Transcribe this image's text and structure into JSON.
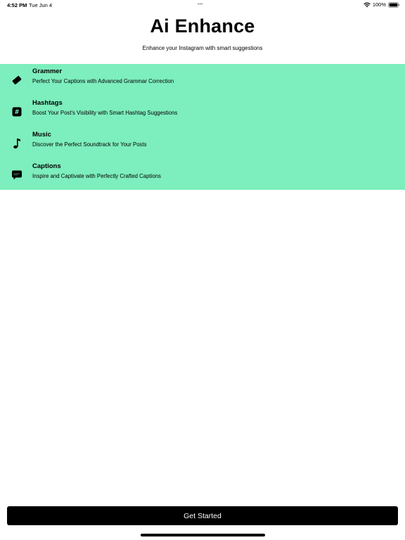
{
  "status_bar": {
    "time": "4:52 PM",
    "date": "Tue Jun 4",
    "dots": "•••",
    "battery_percent": "100%"
  },
  "header": {
    "title": "Ai Enhance",
    "subtitle": "Enhance your Instagram with smart suggestions"
  },
  "features": [
    {
      "icon": "eraser-icon",
      "title": "Grammer",
      "description": "Perfect Your Captions with Advanced Grammar Correction"
    },
    {
      "icon": "hashtag-icon",
      "title": "Hashtags",
      "description": "Boost Your Post's Visibility with Smart Hashtag Suggestions"
    },
    {
      "icon": "music-note-icon",
      "title": "Music",
      "description": "Discover the Perfect Soundtrack for Your Posts"
    },
    {
      "icon": "speech-bubble-icon",
      "title": "Captions",
      "description": "Inspire and Captivate with Perfectly Crafted Captions"
    }
  ],
  "colors": {
    "panel_background": "#7deebd",
    "button_background": "#000000",
    "button_text": "#ffffff"
  },
  "cta": {
    "label": "Get Started"
  }
}
